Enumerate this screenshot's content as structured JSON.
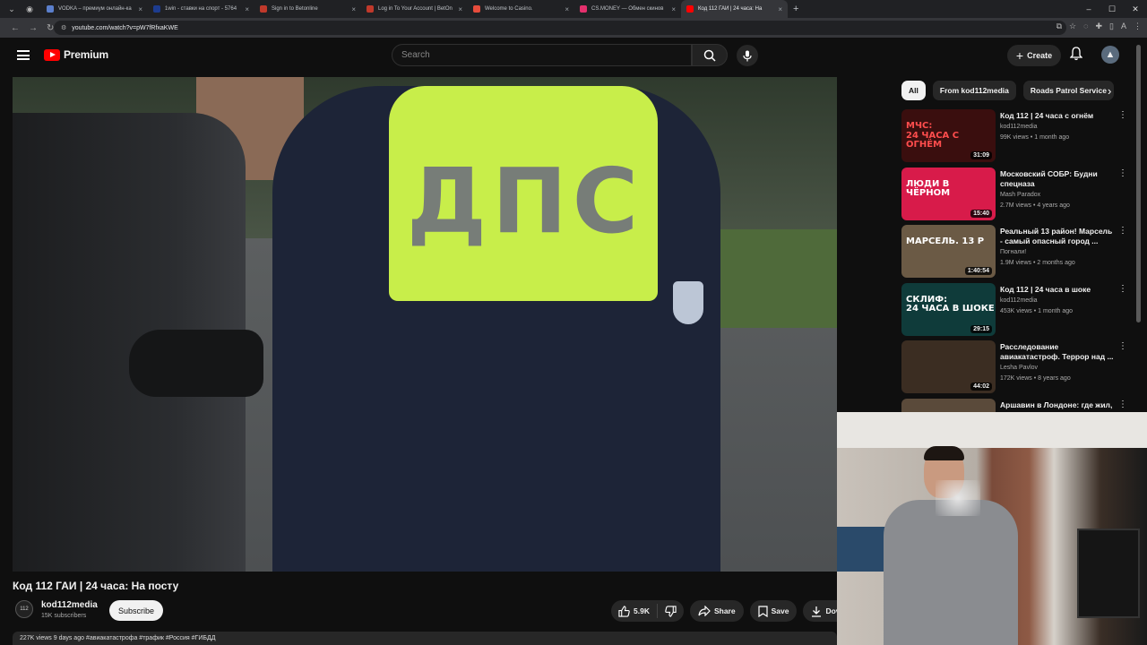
{
  "browser": {
    "tabs": [
      {
        "title": "VODKA – премиум онлайн-ка",
        "color": "#5b7fcc"
      },
      {
        "title": "1win - ставки на спорт - 5764",
        "color": "#1d3c8f"
      },
      {
        "title": "Sign in to Betonline",
        "color": "#c0392b"
      },
      {
        "title": "Log in To Your Account | BetOn",
        "color": "#c0392b"
      },
      {
        "title": "Welcome to Casino.",
        "color": "#e74c3c"
      },
      {
        "title": "CS.MONEY — Обмен скинов",
        "color": "#e5306d"
      },
      {
        "title": "Код 112 ГАИ | 24 часа: На",
        "color": "#ff0000"
      }
    ],
    "url": "youtube.com/watch?v=pW7fRfxaKWE"
  },
  "header": {
    "logo_text": "Premium",
    "search_placeholder": "Search",
    "create_label": "Create"
  },
  "video": {
    "title": "Код 112 ГАИ | 24 часа: На посту",
    "vest_text": "ДПС",
    "channel": "kod112media",
    "subscribers": "15K subscribers",
    "channel_avatar": "112",
    "subscribe_label": "Subscribe",
    "likes": "5.9K",
    "share_label": "Share",
    "save_label": "Save",
    "download_label": "Dov",
    "description_line": "227K views  9 days ago  #авиакатастрофа #трафик #Россия #ГИБДД"
  },
  "chips": [
    "All",
    "From kod112media",
    "Roads Patrol Service"
  ],
  "recommendations": [
    {
      "title": "Код 112 | 24 часа с огнём",
      "channel": "kod112media",
      "meta": "99K views • 1 month ago",
      "duration": "31:09",
      "thumb_text": "МЧС:\n24 ЧАСА С ОГНЁМ",
      "thumb_bg": "#3a0e0e",
      "thumb_fg": "#ff4d4d"
    },
    {
      "title": "Московский СОБР: Будни спецназа",
      "channel": "Mash Paradox",
      "meta": "2.7M views • 4 years ago",
      "duration": "15:40",
      "thumb_text": "ЛЮДИ В ЧЁРНОМ",
      "thumb_bg": "#d81b4a",
      "thumb_fg": "#ffffff"
    },
    {
      "title": "Реальный 13 район! Марсель - самый опасный город ...",
      "channel": "Погнали!",
      "meta": "1.9M views • 2 months ago",
      "duration": "1:40:54",
      "thumb_text": "МАРСЕЛЬ. 13 Р",
      "thumb_bg": "#6b5a45",
      "thumb_fg": "#ffffff"
    },
    {
      "title": "Код 112 | 24 часа в шоке",
      "channel": "kod112media",
      "meta": "453K views • 1 month ago",
      "duration": "29:15",
      "thumb_text": "СКЛИФ:\n24 ЧАСА В ШОКЕ",
      "thumb_bg": "#0f3b3a",
      "thumb_fg": "#ffffff"
    },
    {
      "title": "Расследование авиакатастроф. Террор над ...",
      "channel": "Lesha Pavlov",
      "meta": "172K views • 8 years ago",
      "duration": "44:02",
      "thumb_text": "",
      "thumb_bg": "#3b2d22",
      "thumb_fg": "#ffffff"
    },
    {
      "title": "Аршавин в Лондоне: где жил,",
      "channel": "",
      "meta": "",
      "duration": "",
      "thumb_text": "",
      "thumb_bg": "#5a4a3a",
      "thumb_fg": "#ffffff"
    }
  ]
}
